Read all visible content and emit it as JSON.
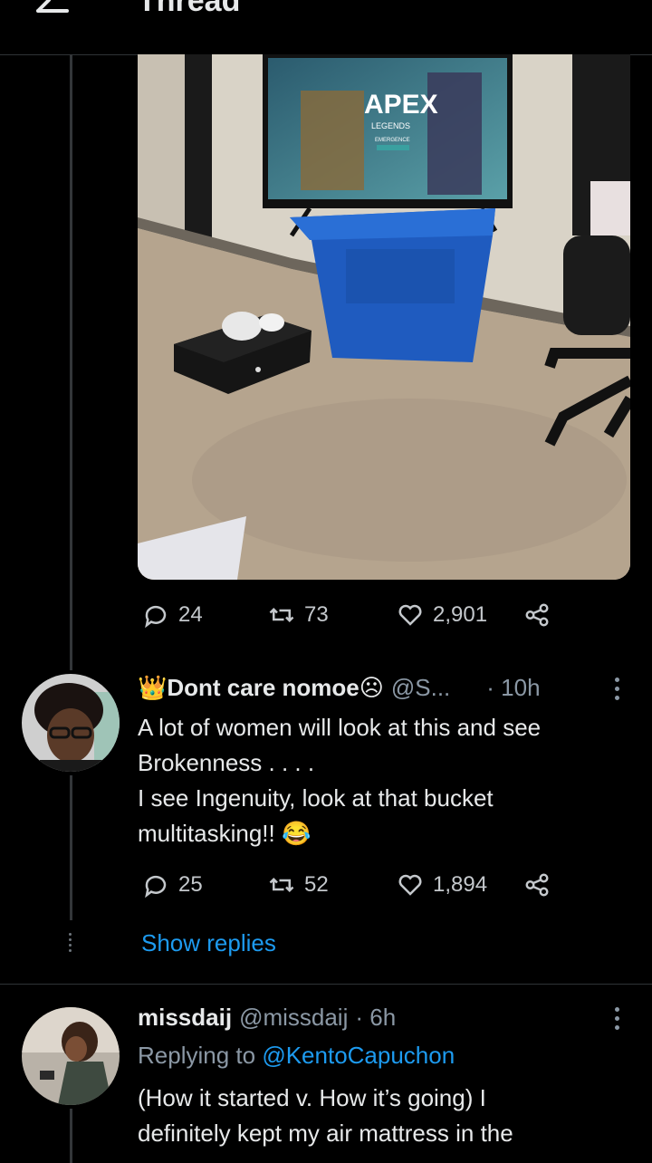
{
  "header": {
    "title": "Thread"
  },
  "tweet_main": {
    "stats": {
      "replies": "24",
      "retweets": "73",
      "likes": "2,901"
    },
    "tv_text": {
      "game": "APEX",
      "subtitle": "LEGENDS",
      "season": "EMERGENCE"
    }
  },
  "reply1": {
    "display_name": "Dont care nomoe",
    "handle": "@S...",
    "time": "· 10h",
    "text": "A lot of women will look at this and see\nBrokenness . . . .\nI see Ingenuity, look at that bucket\nmultitasking!!",
    "stats": {
      "replies": "25",
      "retweets": "52",
      "likes": "1,894"
    },
    "show_replies": "Show replies"
  },
  "reply2": {
    "display_name": "missdaij",
    "handle": "@missdaij",
    "time": "· 6h",
    "replying_prefix": "Replying to ",
    "replying_to": "@KentoCapuchon",
    "text": "(How it started v. How it’s going) I\ndefinitely kept my air mattress in the"
  },
  "colors": {
    "accent": "#1d9bf0",
    "bg": "#000000",
    "bucket": "#1f5bbf"
  }
}
